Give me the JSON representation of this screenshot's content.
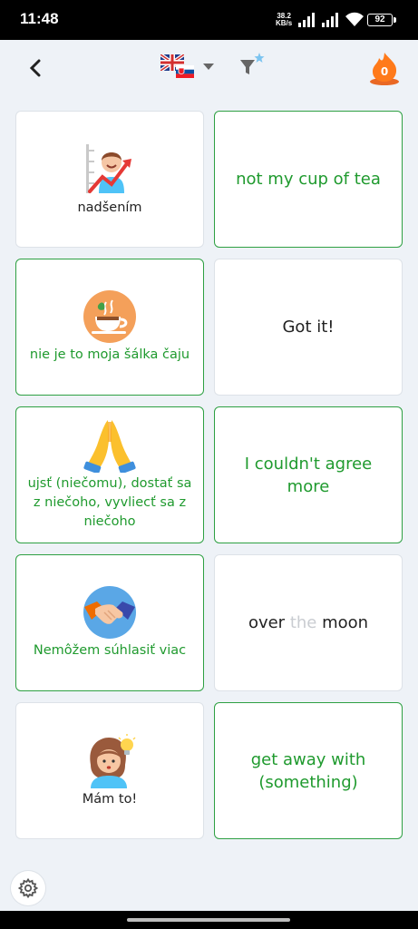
{
  "status_bar": {
    "time": "11:48",
    "net_rate": "38.2",
    "net_unit": "KB/s",
    "battery": "92"
  },
  "header": {
    "back_icon": "chevron-left-icon",
    "language_pair": "English / Slovak",
    "filter_icon": "filter-star-icon",
    "streak_count": "0",
    "streak_color": "#e8590c"
  },
  "colors": {
    "selected_border": "#2ea043",
    "green_text": "#1f9a2e",
    "dark_text": "#222222"
  },
  "cards": [
    {
      "id": "c1",
      "text": "nadšením",
      "icon": "excited-person-chart-icon",
      "text_color": "dark",
      "selected": false
    },
    {
      "id": "c2",
      "text": "not my cup of tea",
      "text_color": "green",
      "selected": true
    },
    {
      "id": "c3",
      "text": "nie je to moja šálka čaju",
      "icon": "tea-cup-icon",
      "text_color": "green",
      "selected": true
    },
    {
      "id": "c4",
      "text": "Got it!",
      "text_color": "dark",
      "selected": false
    },
    {
      "id": "c5",
      "text": "ujsť (niečomu), dostať sa z niečoho, vyvliecť sa z niečoho",
      "icon": "praying-hands-icon",
      "text_color": "green",
      "selected": true
    },
    {
      "id": "c6",
      "text": "I couldn't agree more",
      "text_color": "green",
      "selected": true
    },
    {
      "id": "c7",
      "text": "Nemôžem súhlasiť viac",
      "icon": "handshake-icon",
      "text_color": "green",
      "selected": true
    },
    {
      "id": "c8",
      "text_parts": [
        "over ",
        "the",
        " moon"
      ],
      "text_color": "dark",
      "selected": false
    },
    {
      "id": "c9",
      "text": "Mám to!",
      "icon": "girl-lightbulb-icon",
      "text_color": "dark",
      "selected": false
    },
    {
      "id": "c10",
      "text": "get away with (something)",
      "text_color": "green",
      "selected": true
    }
  ],
  "footer": {
    "settings_icon": "gear-icon"
  }
}
